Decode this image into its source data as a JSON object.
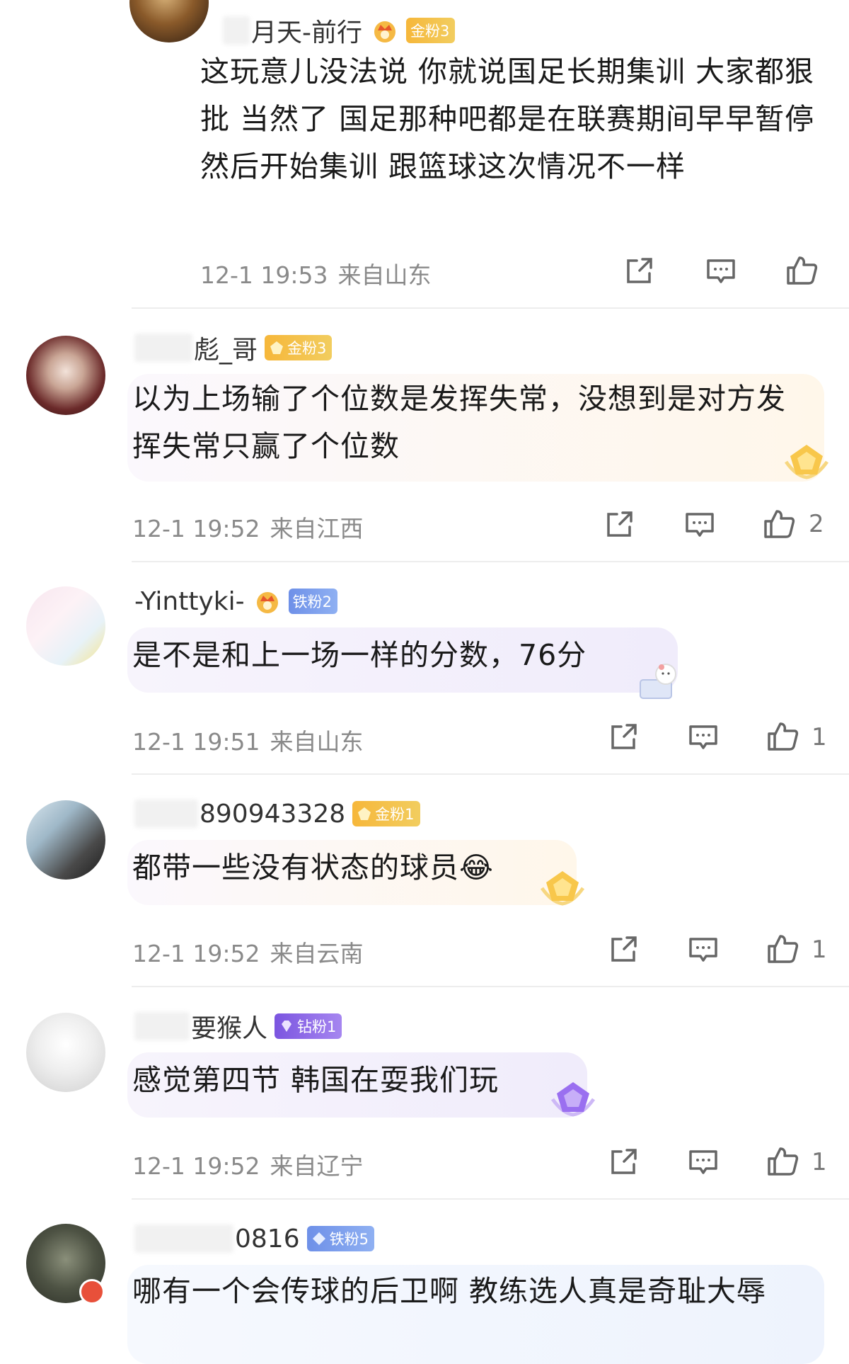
{
  "comments": [
    {
      "username": "月天-前行",
      "badge": "金粉3",
      "text": "这玩意儿没法说 你就说国足长期集训 大家都狠批 当然了 国足那种吧都是在联赛期间早早暂停 然后开始集训 跟篮球这次情况不一样",
      "time": "12-1 19:53",
      "location": "来自山东",
      "likes": ""
    },
    {
      "username": "彪_哥",
      "badge": "金粉3",
      "text": "以为上场输了个位数是发挥失常，没想到是对方发挥失常只赢了个位数",
      "time": "12-1 19:52",
      "location": "来自江西",
      "likes": "2"
    },
    {
      "username": "-Yinttyki-",
      "badge": "铁粉2",
      "text": "是不是和上一场一样的分数，76分",
      "time": "12-1 19:51",
      "location": "来自山东",
      "likes": "1"
    },
    {
      "username": "890943328",
      "badge": "金粉1",
      "text": "都带一些没有状态的球员😂",
      "time": "12-1 19:52",
      "location": "来自云南",
      "likes": "1"
    },
    {
      "username": "要猴人",
      "badge": "钻粉1",
      "text": "感觉第四节 韩国在耍我们玩",
      "time": "12-1 19:52",
      "location": "来自辽宁",
      "likes": "1"
    },
    {
      "username": "0816",
      "badge": "铁粉5",
      "text": "哪有一个会传球的后卫啊 教练选人真是奇耻大辱",
      "time": "",
      "location": "",
      "likes": ""
    }
  ],
  "colors": {
    "gold_badge": "#f4bd45",
    "iron_badge": "#7a9cec",
    "diamond_badge": "#8c66e8",
    "meta_text": "#8a8a8a"
  },
  "icons": [
    "share-icon",
    "comment-icon",
    "like-icon"
  ]
}
